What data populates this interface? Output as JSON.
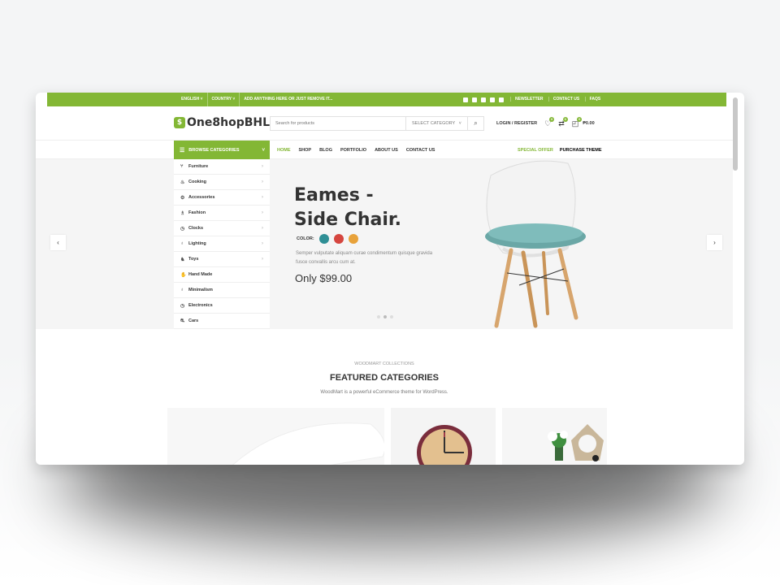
{
  "colors": {
    "accent": "#83b735",
    "text": "#333333",
    "muted": "#888888"
  },
  "topbar": {
    "language": "ENGLISH ˅",
    "country": "COUNTRY ˅",
    "promo": "ADD ANYTHING HERE OR JUST REMOVE IT...",
    "social_icons": [
      "facebook-icon",
      "twitter-icon",
      "instagram-icon",
      "youtube-icon",
      "pinterest-icon"
    ],
    "links": [
      "NEWSLETTER",
      "CONTACT US",
      "FAQS"
    ]
  },
  "header": {
    "logo_text": "One8hopBHL",
    "search_placeholder": "Search for products",
    "category_select": "SELECT CATEGORY",
    "login": "LOGIN / REGISTER",
    "wishlist_count": "0",
    "compare_count": "0",
    "cart_count": "0",
    "cart_total": "₱0.00"
  },
  "nav": {
    "browse": "BROWSE CATEGORIES",
    "menu": [
      "HOME",
      "SHOP",
      "BLOG",
      "PORTFOLIO",
      "ABOUT US",
      "CONTACT US"
    ],
    "special": "SPECIAL OFFER",
    "purchase": "PURCHASE THEME"
  },
  "categories": [
    {
      "label": "Furniture",
      "icon": "chair-icon",
      "arrow": true
    },
    {
      "label": "Cooking",
      "icon": "cooking-icon",
      "arrow": true
    },
    {
      "label": "Accessories",
      "icon": "accessories-icon",
      "arrow": true
    },
    {
      "label": "Fashion",
      "icon": "fashion-icon",
      "arrow": true
    },
    {
      "label": "Clocks",
      "icon": "clock-icon",
      "arrow": true
    },
    {
      "label": "Lighting",
      "icon": "bulb-icon",
      "arrow": true
    },
    {
      "label": "Toys",
      "icon": "toy-icon",
      "arrow": true
    },
    {
      "label": "Hand Made",
      "icon": "handmade-icon",
      "arrow": false
    },
    {
      "label": "Minimalism",
      "icon": "minimalism-icon",
      "arrow": false
    },
    {
      "label": "Electronics",
      "icon": "electronics-icon",
      "arrow": false
    },
    {
      "label": "Cars",
      "icon": "car-icon",
      "arrow": false
    }
  ],
  "hero": {
    "title_line1": "Eames -",
    "title_line2": "Side Chair.",
    "color_label": "COLOR:",
    "swatches": [
      "#2f8f95",
      "#d5463f",
      "#e8a23a"
    ],
    "description": "Semper vulputate aliquam curae condimentum quisque gravida fusce convallis arcu cum at.",
    "price": "Only $99.00"
  },
  "featured": {
    "subtitle": "WOODMART COLLECTIONS",
    "title": "FEATURED CATEGORIES",
    "description": "WoodMart is a powerful eCommerce theme for WordPress."
  }
}
